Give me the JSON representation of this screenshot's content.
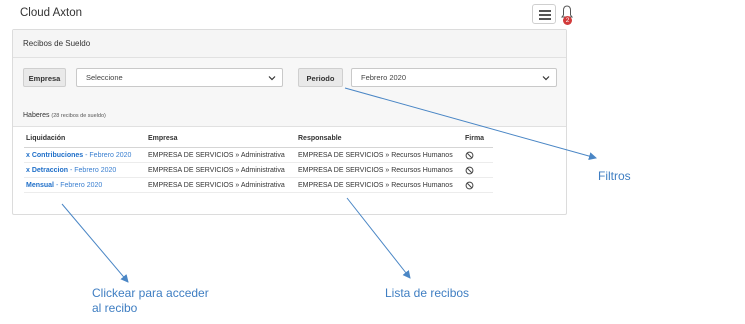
{
  "app": {
    "title": "Cloud Axton",
    "notifications_count": "2"
  },
  "panel": {
    "title": "Recibos de Sueldo",
    "filters": {
      "empresa_label": "Empresa",
      "empresa_value": "Seleccione",
      "periodo_label": "Periodo",
      "periodo_value": "Febrero 2020"
    },
    "section_title": "Haberes",
    "section_count": "(28 recibos de sueldo)",
    "table": {
      "headers": [
        "Liquidación",
        "Empresa",
        "Responsable",
        "Firma"
      ],
      "rows": [
        {
          "name": "x Contribuciones",
          "period": " - Febrero 2020",
          "empresa": "EMPRESA DE SERVICIOS » Administrativa",
          "responsable": "EMPRESA DE SERVICIOS » Recursos Humanos"
        },
        {
          "name": "x Detraccion",
          "period": " - Febrero 2020",
          "empresa": "EMPRESA DE SERVICIOS » Administrativa",
          "responsable": "EMPRESA DE SERVICIOS » Recursos Humanos"
        },
        {
          "name": "Mensual",
          "period": " - Febrero 2020",
          "empresa": "EMPRESA DE SERVICIOS » Administrativa",
          "responsable": "EMPRESA DE SERVICIOS » Recursos Humanos"
        }
      ]
    }
  },
  "annotations": {
    "filtros": "Filtros",
    "clickear_line1": "Clickear para acceder",
    "clickear_line2": "al recibo",
    "lista": "Lista de recibos"
  },
  "colors": {
    "accent": "#1f6fc9",
    "annotation": "#3f7ec2",
    "badge": "#d23b3b"
  },
  "icons": {
    "menu": "hamburger-icon",
    "notifications": "bell-icon",
    "signature_status": "not-allowed-icon"
  }
}
